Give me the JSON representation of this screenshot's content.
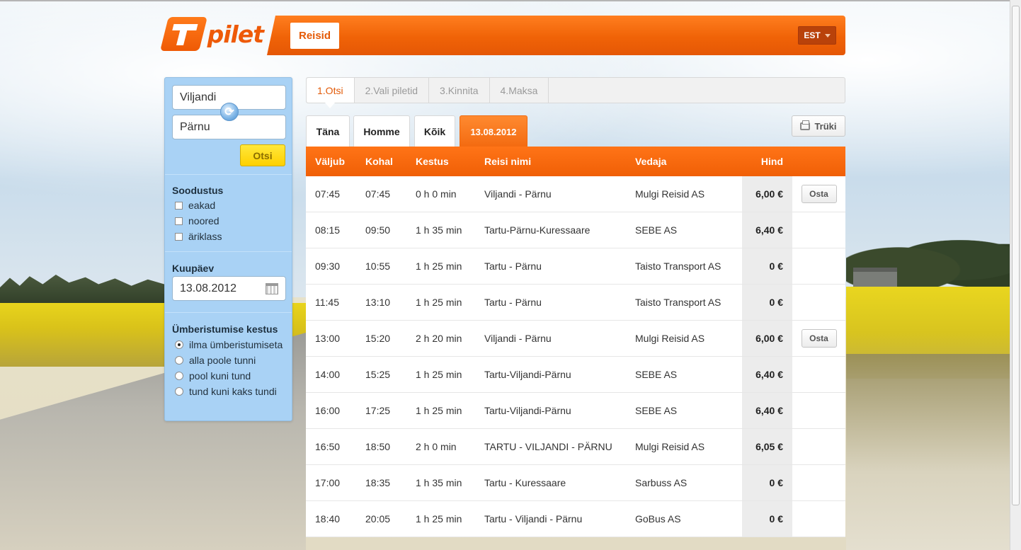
{
  "brand": {
    "logo_text": "pilet"
  },
  "nav": {
    "active_item": "Reisid"
  },
  "language": {
    "selected": "EST"
  },
  "search": {
    "from_value": "Viljandi",
    "to_value": "Pärnu",
    "search_label": "Otsi"
  },
  "discounts": {
    "title": "Soodustus",
    "options": [
      {
        "label": "eakad",
        "checked": false
      },
      {
        "label": "noored",
        "checked": false
      },
      {
        "label": "äriklass",
        "checked": false
      }
    ]
  },
  "date": {
    "title": "Kuupäev",
    "value": "13.08.2012"
  },
  "transfer": {
    "title": "Ümberistumise kestus",
    "options": [
      {
        "label": "ilma ümberistumiseta",
        "selected": true
      },
      {
        "label": "alla poole tunni",
        "selected": false
      },
      {
        "label": "pool kuni tund",
        "selected": false
      },
      {
        "label": "tund kuni kaks tundi",
        "selected": false
      }
    ]
  },
  "steps": [
    "1.Otsi",
    "2.Vali piletid",
    "3.Kinnita",
    "4.Maksa"
  ],
  "day_tabs": [
    "Täna",
    "Homme",
    "Kõik",
    "13.08.2012"
  ],
  "print_label": "Trüki",
  "table": {
    "headers": [
      "Väljub",
      "Kohal",
      "Kestus",
      "Reisi nimi",
      "Vedaja",
      "Hind"
    ],
    "buy_label": "Osta",
    "rows": [
      {
        "depart": "07:45",
        "arrive": "07:45",
        "duration": "0 h 0 min",
        "route": "Viljandi - Pärnu",
        "carrier": "Mulgi Reisid AS",
        "price": "6,00 €",
        "buy": true
      },
      {
        "depart": "08:15",
        "arrive": "09:50",
        "duration": "1 h 35 min",
        "route": "Tartu-Pärnu-Kuressaare",
        "carrier": "SEBE AS",
        "price": "6,40 €",
        "buy": false
      },
      {
        "depart": "09:30",
        "arrive": "10:55",
        "duration": "1 h 25 min",
        "route": "Tartu - Pärnu",
        "carrier": "Taisto Transport AS",
        "price": "0 €",
        "buy": false
      },
      {
        "depart": "11:45",
        "arrive": "13:10",
        "duration": "1 h 25 min",
        "route": "Tartu - Pärnu",
        "carrier": "Taisto Transport AS",
        "price": "0 €",
        "buy": false
      },
      {
        "depart": "13:00",
        "arrive": "15:20",
        "duration": "2 h 20 min",
        "route": "Viljandi - Pärnu",
        "carrier": "Mulgi Reisid AS",
        "price": "6,00 €",
        "buy": true
      },
      {
        "depart": "14:00",
        "arrive": "15:25",
        "duration": "1 h 25 min",
        "route": "Tartu-Viljandi-Pärnu",
        "carrier": "SEBE AS",
        "price": "6,40 €",
        "buy": false
      },
      {
        "depart": "16:00",
        "arrive": "17:25",
        "duration": "1 h 25 min",
        "route": "Tartu-Viljandi-Pärnu",
        "carrier": "SEBE AS",
        "price": "6,40 €",
        "buy": false
      },
      {
        "depart": "16:50",
        "arrive": "18:50",
        "duration": "2 h 0 min",
        "route": "TARTU - VILJANDI - PÄRNU",
        "carrier": "Mulgi Reisid AS",
        "price": "6,05 €",
        "buy": false
      },
      {
        "depart": "17:00",
        "arrive": "18:35",
        "duration": "1 h 35 min",
        "route": "Tartu - Kuressaare",
        "carrier": "Sarbuss AS",
        "price": "0 €",
        "buy": false
      },
      {
        "depart": "18:40",
        "arrive": "20:05",
        "duration": "1 h 25 min",
        "route": "Tartu - Viljandi - Pärnu",
        "carrier": "GoBus AS",
        "price": "0 €",
        "buy": false
      }
    ]
  },
  "colors": {
    "brand_orange": "#f06307",
    "sidebar_blue": "#a9d2f5",
    "search_yellow": "#ffd000"
  }
}
